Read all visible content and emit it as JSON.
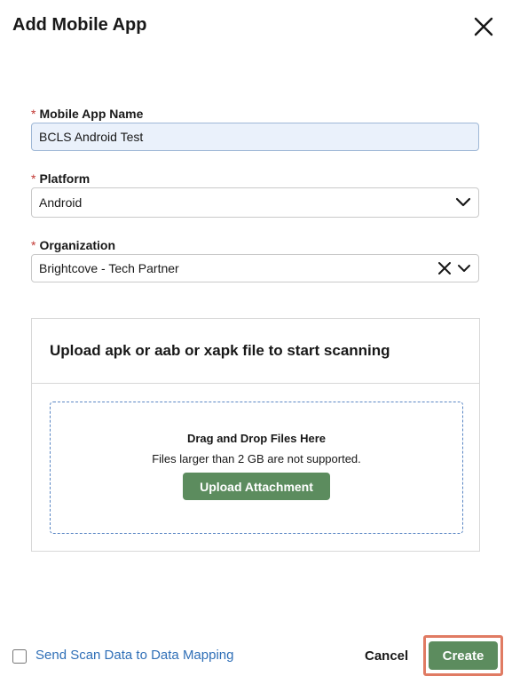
{
  "modal": {
    "title": "Add Mobile App",
    "close_icon": "close-icon"
  },
  "form": {
    "required_marker": "*",
    "app_name": {
      "label": "Mobile App Name",
      "value": "BCLS Android Test"
    },
    "platform": {
      "label": "Platform",
      "value": "Android",
      "icon": "chevron-down-icon"
    },
    "organization": {
      "label": "Organization",
      "value": "Brightcove - Tech Partner",
      "icons": [
        "clear-icon",
        "chevron-down-icon"
      ]
    }
  },
  "upload": {
    "heading": "Upload apk or aab or xapk file to start scanning",
    "drop_title": "Drag and Drop Files Here",
    "drop_note": "Files larger than 2 GB are not supported.",
    "button_label": "Upload Attachment"
  },
  "footer": {
    "checkbox_label": "Send Scan Data to Data Mapping",
    "checkbox_checked": false,
    "cancel_label": "Cancel",
    "create_label": "Create"
  },
  "colors": {
    "primary_button": "#5c8c5e",
    "link": "#2f6fb7",
    "required": "#c23934",
    "focus_highlight": "#e07b63",
    "active_input_bg": "#eaf1fb",
    "dropzone_border": "#5b87c4"
  }
}
